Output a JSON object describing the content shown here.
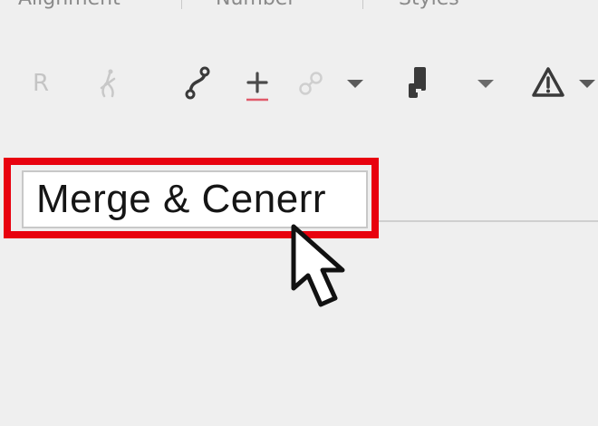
{
  "tabs": [
    "Alignment",
    "Number",
    "Styles"
  ],
  "toolbar": {
    "items": [
      {
        "name": "r-icon",
        "glyph": "R"
      },
      {
        "name": "anchor-icon"
      },
      {
        "name": "curve-icon"
      },
      {
        "name": "plus-icon"
      },
      {
        "name": "link-icon"
      },
      {
        "name": "chevron-down-icon"
      },
      {
        "name": "bin-icon"
      },
      {
        "name": "chevron-down-icon"
      },
      {
        "name": "warning-icon"
      },
      {
        "name": "chevron-down-icon"
      }
    ]
  },
  "tooltip": {
    "text": "Merge & Cenerr"
  },
  "colors": {
    "highlight": "#e8020f",
    "background": "#efefef",
    "accent_underline": "#e05a6a"
  }
}
